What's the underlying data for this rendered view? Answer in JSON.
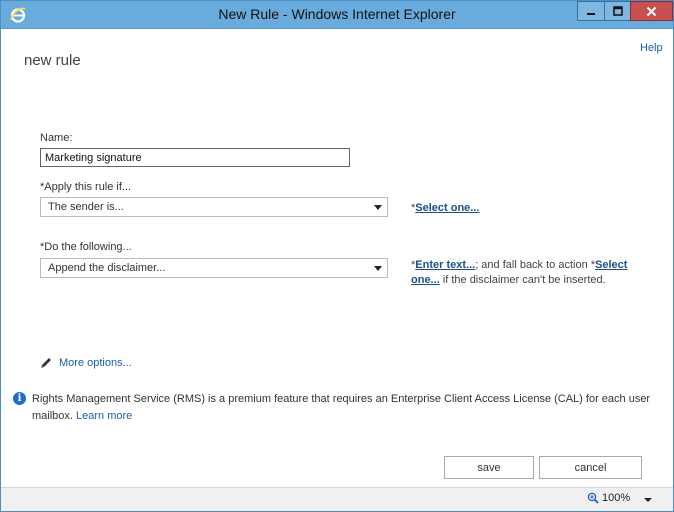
{
  "window": {
    "title": "New Rule - Windows Internet Explorer",
    "controls": {
      "minimize": "minimize-icon",
      "maximize": "maximize-icon",
      "close": "close-icon"
    }
  },
  "header": {
    "help": "Help",
    "page_title": "new rule"
  },
  "form": {
    "name_label": "Name:",
    "name_value": "Marketing signature",
    "apply_label": "*Apply this rule if...",
    "apply_value": "The sender is...",
    "apply_side": {
      "prefix": "*",
      "link": "Select one..."
    },
    "do_label": "*Do the following...",
    "do_value": "Append the disclaimer...",
    "do_side": {
      "prefix": "*",
      "link1": "Enter text...",
      "middle": "; and fall back to action *",
      "link2": "Select one...",
      "suffix": " if the disclaimer can't be inserted."
    },
    "more_options": "More options..."
  },
  "info": {
    "text": "Rights Management Service (RMS) is a premium feature that requires an Enterprise Client Access License (CAL) for each user mailbox. ",
    "link": "Learn more"
  },
  "buttons": {
    "save": "save",
    "cancel": "cancel"
  },
  "statusbar": {
    "zoom": "100%"
  },
  "colors": {
    "titlebar": "#6aabdd",
    "close": "#c75050",
    "link": "#1b5fa6"
  }
}
